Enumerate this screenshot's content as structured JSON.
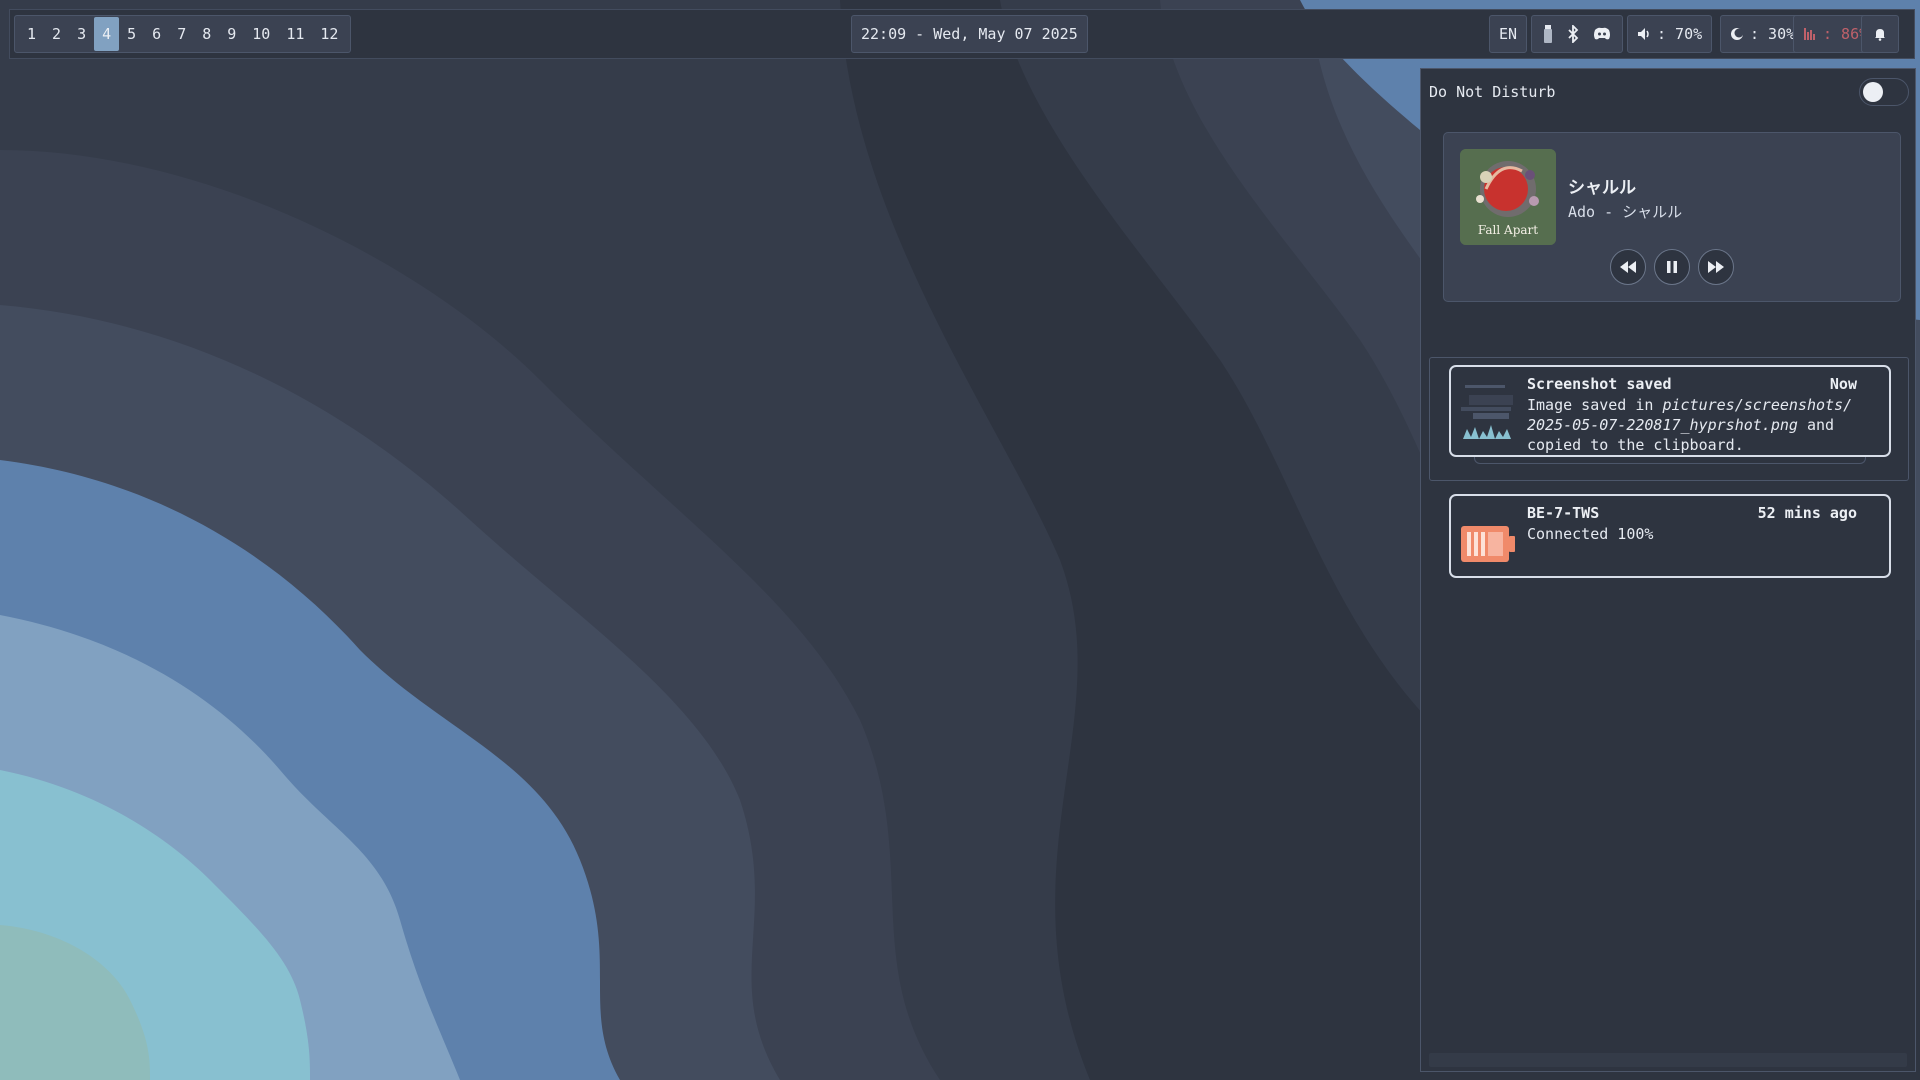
{
  "colors": {
    "background": "#2e3440",
    "accent": "#81a1c1",
    "warning": "#bf616a",
    "battery": "#f08a6a"
  },
  "topbar": {
    "workspaces": [
      "1",
      "2",
      "3",
      "4",
      "5",
      "6",
      "7",
      "8",
      "9",
      "10",
      "11",
      "12"
    ],
    "active_workspace": "4",
    "clock": "22:09 - Wed, May 07 2025",
    "language": "EN",
    "tray_icons": [
      "usb-drive-icon",
      "bluetooth-icon",
      "discord-icon"
    ],
    "volume": ": 70%",
    "brightness": ": 30%",
    "memory": ": 86%"
  },
  "panel": {
    "dnd_label": "Do Not Disturb",
    "dnd_enabled": false,
    "media": {
      "title": "シャルル",
      "artist": "Ado - シャルル",
      "cover_text": "Fall Apart",
      "controls": [
        "previous",
        "pause",
        "next"
      ]
    },
    "notifications": [
      {
        "title": "Screenshot saved",
        "time": "Now",
        "body_prefix": "Image saved in ",
        "body_path": "pictures/screenshots/ 2025-05-07-220817_hyprshot.png",
        "body_suffix": " and copied to the clipboard."
      },
      {
        "title": "BE-7-TWS",
        "time": "52 mins ago",
        "body": "Connected 100%"
      }
    ]
  }
}
